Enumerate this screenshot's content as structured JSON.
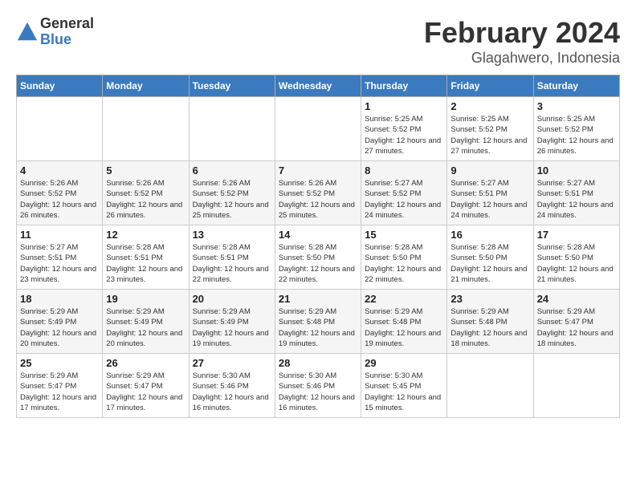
{
  "logo": {
    "general": "General",
    "blue": "Blue"
  },
  "title": "February 2024",
  "location": "Glagahwero, Indonesia",
  "days_header": [
    "Sunday",
    "Monday",
    "Tuesday",
    "Wednesday",
    "Thursday",
    "Friday",
    "Saturday"
  ],
  "weeks": [
    [
      {
        "day": "",
        "info": ""
      },
      {
        "day": "",
        "info": ""
      },
      {
        "day": "",
        "info": ""
      },
      {
        "day": "",
        "info": ""
      },
      {
        "day": "1",
        "info": "Sunrise: 5:25 AM\nSunset: 5:52 PM\nDaylight: 12 hours and 27 minutes."
      },
      {
        "day": "2",
        "info": "Sunrise: 5:25 AM\nSunset: 5:52 PM\nDaylight: 12 hours and 27 minutes."
      },
      {
        "day": "3",
        "info": "Sunrise: 5:25 AM\nSunset: 5:52 PM\nDaylight: 12 hours and 26 minutes."
      }
    ],
    [
      {
        "day": "4",
        "info": "Sunrise: 5:26 AM\nSunset: 5:52 PM\nDaylight: 12 hours and 26 minutes."
      },
      {
        "day": "5",
        "info": "Sunrise: 5:26 AM\nSunset: 5:52 PM\nDaylight: 12 hours and 26 minutes."
      },
      {
        "day": "6",
        "info": "Sunrise: 5:26 AM\nSunset: 5:52 PM\nDaylight: 12 hours and 25 minutes."
      },
      {
        "day": "7",
        "info": "Sunrise: 5:26 AM\nSunset: 5:52 PM\nDaylight: 12 hours and 25 minutes."
      },
      {
        "day": "8",
        "info": "Sunrise: 5:27 AM\nSunset: 5:52 PM\nDaylight: 12 hours and 24 minutes."
      },
      {
        "day": "9",
        "info": "Sunrise: 5:27 AM\nSunset: 5:51 PM\nDaylight: 12 hours and 24 minutes."
      },
      {
        "day": "10",
        "info": "Sunrise: 5:27 AM\nSunset: 5:51 PM\nDaylight: 12 hours and 24 minutes."
      }
    ],
    [
      {
        "day": "11",
        "info": "Sunrise: 5:27 AM\nSunset: 5:51 PM\nDaylight: 12 hours and 23 minutes."
      },
      {
        "day": "12",
        "info": "Sunrise: 5:28 AM\nSunset: 5:51 PM\nDaylight: 12 hours and 23 minutes."
      },
      {
        "day": "13",
        "info": "Sunrise: 5:28 AM\nSunset: 5:51 PM\nDaylight: 12 hours and 22 minutes."
      },
      {
        "day": "14",
        "info": "Sunrise: 5:28 AM\nSunset: 5:50 PM\nDaylight: 12 hours and 22 minutes."
      },
      {
        "day": "15",
        "info": "Sunrise: 5:28 AM\nSunset: 5:50 PM\nDaylight: 12 hours and 22 minutes."
      },
      {
        "day": "16",
        "info": "Sunrise: 5:28 AM\nSunset: 5:50 PM\nDaylight: 12 hours and 21 minutes."
      },
      {
        "day": "17",
        "info": "Sunrise: 5:28 AM\nSunset: 5:50 PM\nDaylight: 12 hours and 21 minutes."
      }
    ],
    [
      {
        "day": "18",
        "info": "Sunrise: 5:29 AM\nSunset: 5:49 PM\nDaylight: 12 hours and 20 minutes."
      },
      {
        "day": "19",
        "info": "Sunrise: 5:29 AM\nSunset: 5:49 PM\nDaylight: 12 hours and 20 minutes."
      },
      {
        "day": "20",
        "info": "Sunrise: 5:29 AM\nSunset: 5:49 PM\nDaylight: 12 hours and 19 minutes."
      },
      {
        "day": "21",
        "info": "Sunrise: 5:29 AM\nSunset: 5:48 PM\nDaylight: 12 hours and 19 minutes."
      },
      {
        "day": "22",
        "info": "Sunrise: 5:29 AM\nSunset: 5:48 PM\nDaylight: 12 hours and 19 minutes."
      },
      {
        "day": "23",
        "info": "Sunrise: 5:29 AM\nSunset: 5:48 PM\nDaylight: 12 hours and 18 minutes."
      },
      {
        "day": "24",
        "info": "Sunrise: 5:29 AM\nSunset: 5:47 PM\nDaylight: 12 hours and 18 minutes."
      }
    ],
    [
      {
        "day": "25",
        "info": "Sunrise: 5:29 AM\nSunset: 5:47 PM\nDaylight: 12 hours and 17 minutes."
      },
      {
        "day": "26",
        "info": "Sunrise: 5:29 AM\nSunset: 5:47 PM\nDaylight: 12 hours and 17 minutes."
      },
      {
        "day": "27",
        "info": "Sunrise: 5:30 AM\nSunset: 5:46 PM\nDaylight: 12 hours and 16 minutes."
      },
      {
        "day": "28",
        "info": "Sunrise: 5:30 AM\nSunset: 5:46 PM\nDaylight: 12 hours and 16 minutes."
      },
      {
        "day": "29",
        "info": "Sunrise: 5:30 AM\nSunset: 5:45 PM\nDaylight: 12 hours and 15 minutes."
      },
      {
        "day": "",
        "info": ""
      },
      {
        "day": "",
        "info": ""
      }
    ]
  ]
}
